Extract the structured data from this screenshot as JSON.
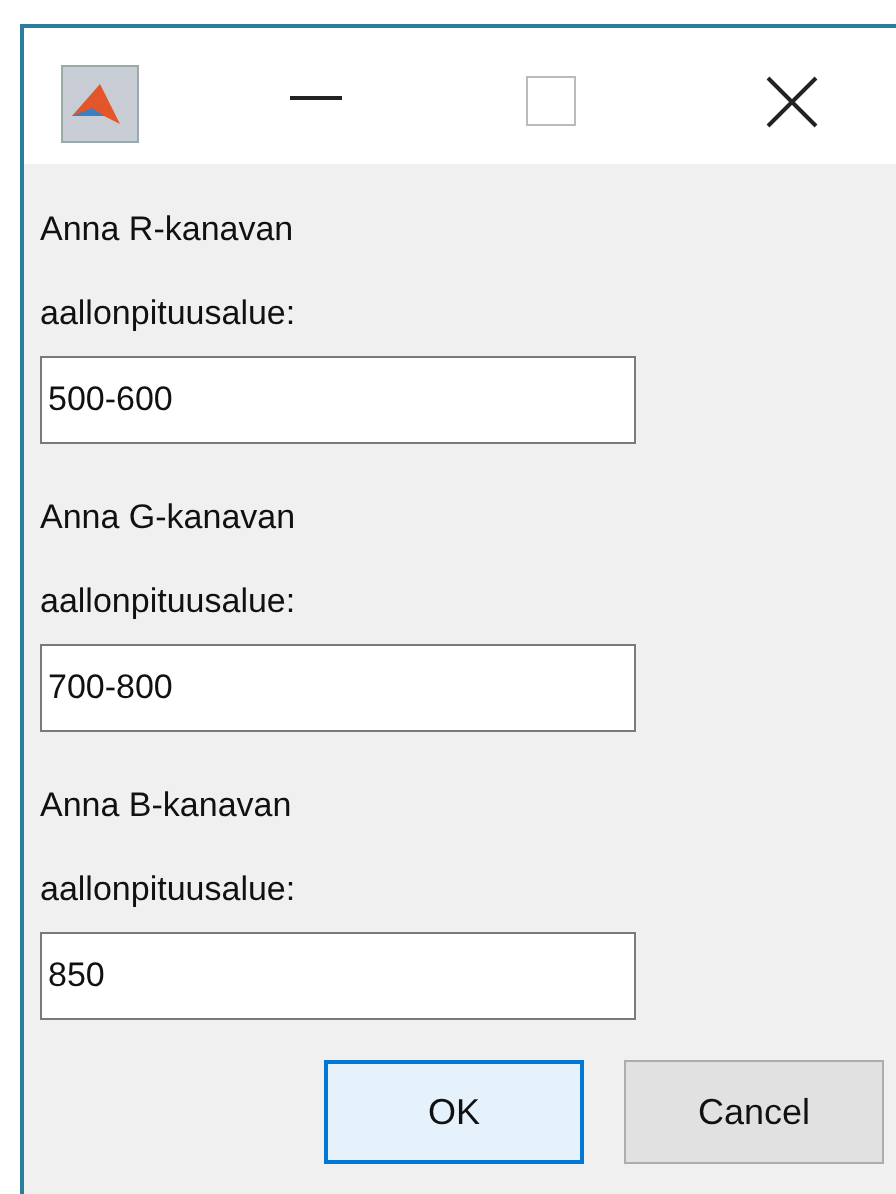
{
  "fields": [
    {
      "label": "Anna R-kanavan aallonpituusalue:",
      "value": "500-600"
    },
    {
      "label": "Anna G-kanavan aallonpituusalue:",
      "value": "700-800"
    },
    {
      "label": "Anna B-kanavan aallonpituusalue:",
      "value": "850"
    }
  ],
  "buttons": [
    {
      "label": "OK",
      "selected": true
    },
    {
      "label": "Cancel",
      "selected": false
    }
  ]
}
